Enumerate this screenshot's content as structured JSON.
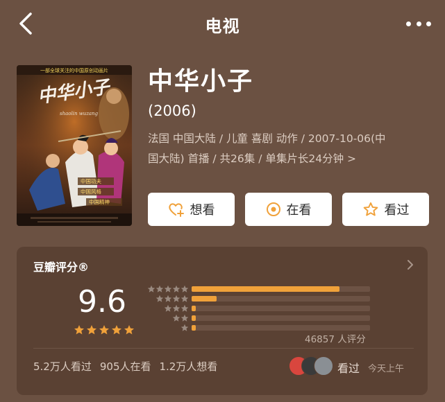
{
  "header": {
    "title": "电视",
    "back_icon": "chevron-left-icon",
    "more_icon": "more-dots-icon"
  },
  "poster": {
    "headline": "一部全球关注的中国原创动画片",
    "title_art": "中华小子",
    "subtitle_art": "shaolin wuzang",
    "tags": [
      "中国功夫",
      "中国风格",
      "中国精神"
    ]
  },
  "show": {
    "title": "中华小子",
    "year": "(2006)",
    "meta_line1": "法国 中国大陆 / 儿童 喜剧 动作 / 2007-10-06(中",
    "meta_line2": "国大陆) 首播 / 共26集 / 单集片长24分钟",
    "meta_arrow": ">"
  },
  "actions": [
    {
      "label": "想看",
      "icon": "heart-plus-icon"
    },
    {
      "label": "在看",
      "icon": "target-circle-icon"
    },
    {
      "label": "看过",
      "icon": "star-outline-icon"
    }
  ],
  "rating": {
    "label": "豆瓣评分®",
    "score": "9.6",
    "stars": 5,
    "distribution_pct": [
      0.83,
      0.14,
      0.015,
      0.007,
      0.007
    ],
    "count": "46857 人评分",
    "stats": {
      "watched": "5.2万人看过",
      "watching": "905人在看",
      "want": "1.2万人想看"
    },
    "friends_label": "看过",
    "time": "今天上午",
    "colors": {
      "accent": "#f0a13a",
      "card": "#5a4133",
      "background": "#6b5142"
    }
  }
}
